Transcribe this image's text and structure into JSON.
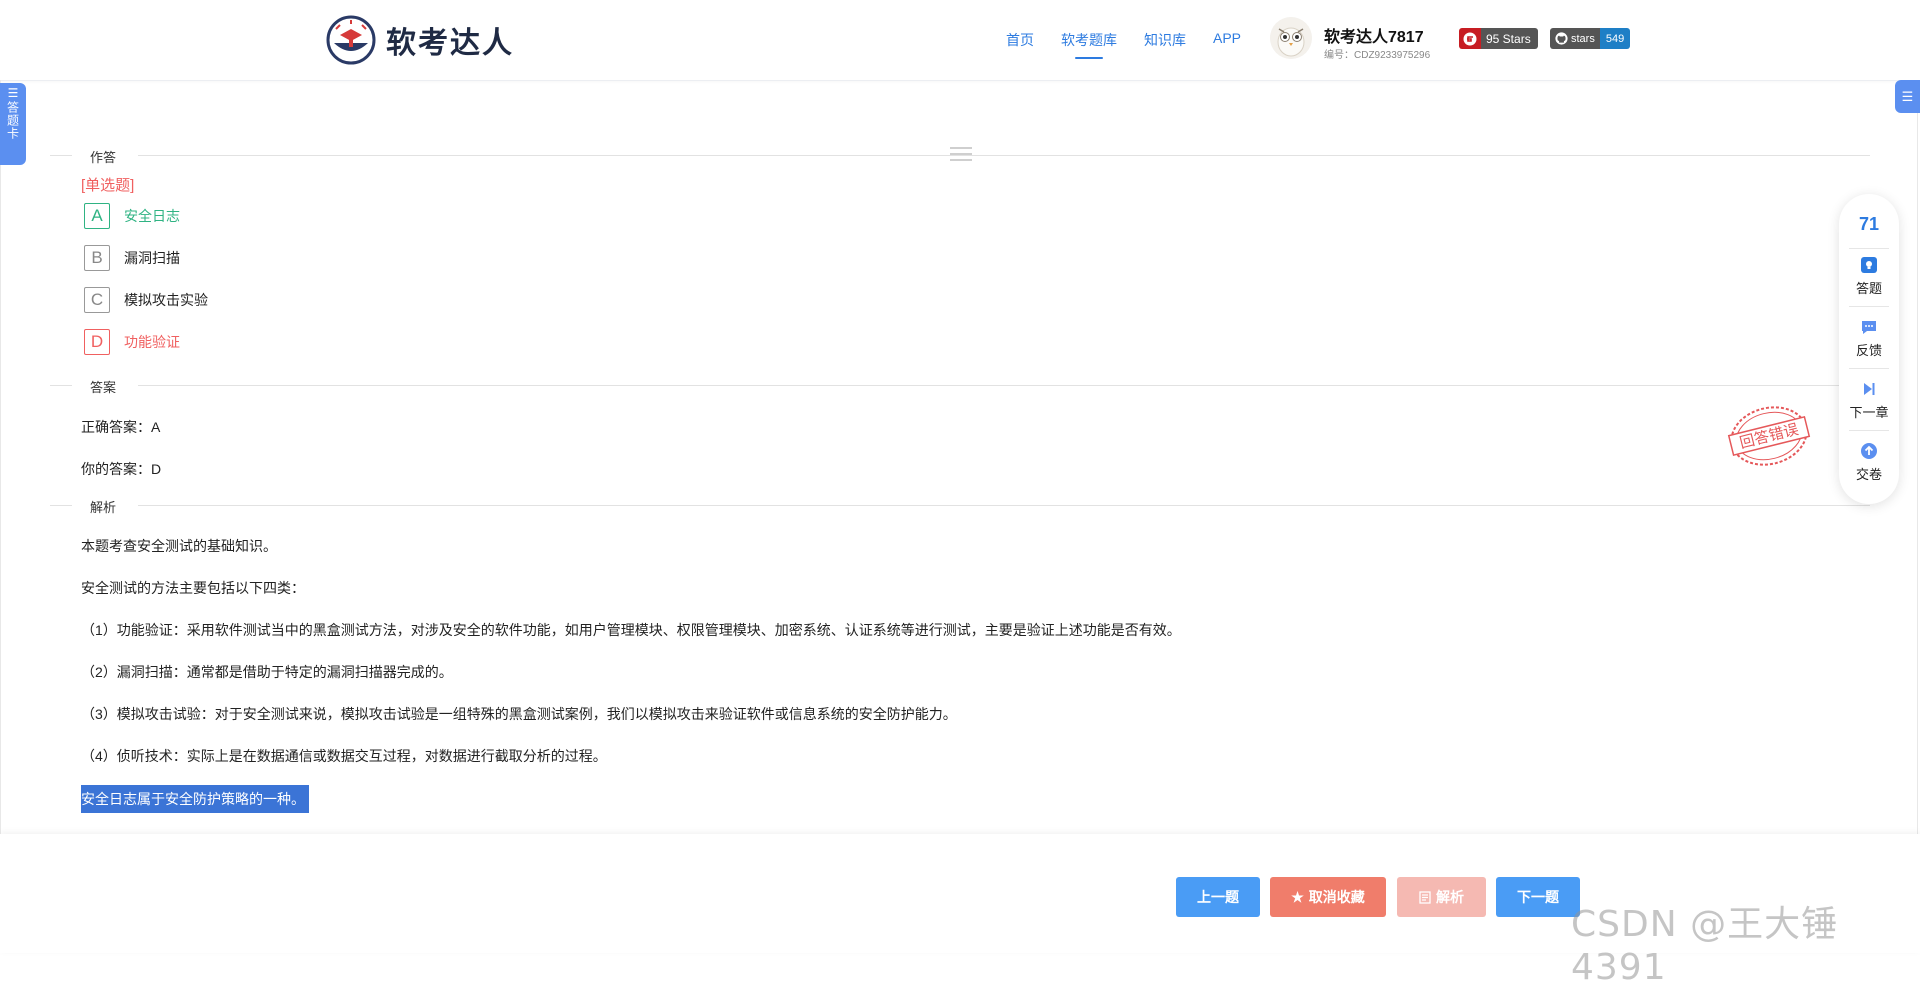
{
  "header": {
    "logo_text": "软考达人",
    "nav": [
      "首页",
      "软考题库",
      "知识库",
      "APP"
    ],
    "active_nav": 1,
    "user_name": "软考达人7817",
    "user_id": "编号：CDZ9233975296",
    "gitee_badge": "95 Stars",
    "github_label": "stars",
    "github_count": "549"
  },
  "side_card": {
    "label": "答题卡"
  },
  "sections": {
    "answer_area": "作答",
    "answer": "答案",
    "analysis": "解析"
  },
  "question": {
    "type": "[单选题]",
    "options": [
      {
        "letter": "A",
        "text": "安全日志",
        "state": "correct"
      },
      {
        "letter": "B",
        "text": "漏洞扫描",
        "state": "normal"
      },
      {
        "letter": "C",
        "text": "模拟攻击实验",
        "state": "normal"
      },
      {
        "letter": "D",
        "text": "功能验证",
        "state": "wrong"
      }
    ]
  },
  "answer": {
    "correct": "正确答案：A",
    "yours": "你的答案：D"
  },
  "stamp_text": "回答错误",
  "analysis": {
    "lines": [
      "本题考查安全测试的基础知识。",
      "安全测试的方法主要包括以下四类：",
      "（1）功能验证：采用软件测试当中的黑盒测试方法，对涉及安全的软件功能，如用户管理模块、权限管理模块、加密系统、认证系统等进行测试，主要是验证上述功能是否有效。",
      "（2）漏洞扫描：通常都是借助于特定的漏洞扫描器完成的。",
      "（3）模拟攻击试验：对于安全测试来说，模拟攻击试验是一组特殊的黑盒测试案例，我们以模拟攻击来验证软件或信息系统的安全防护能力。",
      "（4）侦听技术：实际上是在数据通信或数据交互过程，对数据进行截取分析的过程。"
    ],
    "highlighted": "安全日志属于安全防护策略的一种。"
  },
  "float_panel": {
    "count": "71",
    "items": [
      "答题",
      "反馈",
      "下一章",
      "交卷"
    ]
  },
  "buttons": {
    "prev": "上一题",
    "fav": "取消收藏",
    "analysis": "解析",
    "next": "下一题"
  },
  "watermark": "CSDN @王大锤4391",
  "colors": {
    "primary": "#2d7be0",
    "correct": "#2fb383",
    "wrong": "#f06060",
    "button_blue": "#4a9cf5",
    "button_red": "#f07d6b"
  }
}
